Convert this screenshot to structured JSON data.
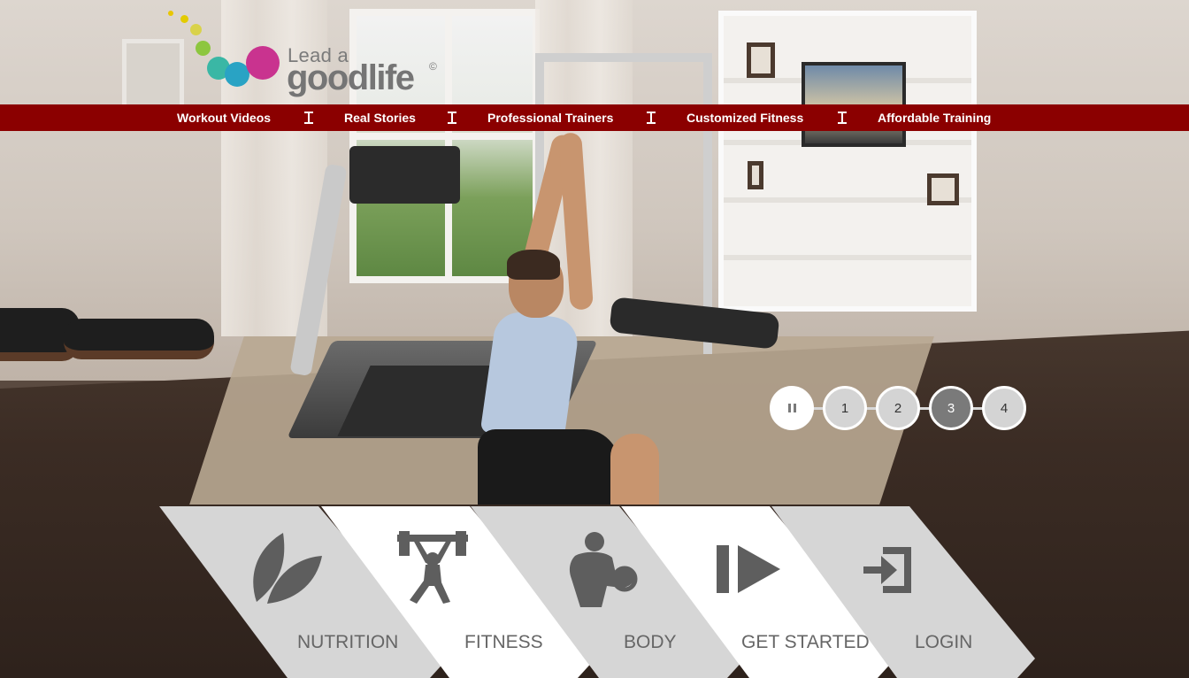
{
  "logo": {
    "line1": "Lead a",
    "line2": "goodlife",
    "copyright": "©"
  },
  "nav": {
    "items": [
      {
        "label": "Workout Videos"
      },
      {
        "label": "Real Stories"
      },
      {
        "label": "Professional Trainers"
      },
      {
        "label": "Customized Fitness"
      },
      {
        "label": "Affordable Training"
      }
    ]
  },
  "slider": {
    "pages": [
      "1",
      "2",
      "3",
      "4"
    ],
    "active_page": "3"
  },
  "menu": {
    "tiles": [
      {
        "label": "NUTRITION",
        "icon": "leaf-icon"
      },
      {
        "label": "FITNESS",
        "icon": "weightlifter-icon"
      },
      {
        "label": "BODY",
        "icon": "bicep-curl-icon"
      },
      {
        "label": "GET STARTED",
        "icon": "play-next-icon"
      },
      {
        "label": "LOGIN",
        "icon": "login-icon"
      }
    ]
  },
  "colors": {
    "nav_background": "#8b0000",
    "tile_light": "#ffffff",
    "tile_gray": "#d6d6d6",
    "icon_gray": "#5e5e5e"
  }
}
